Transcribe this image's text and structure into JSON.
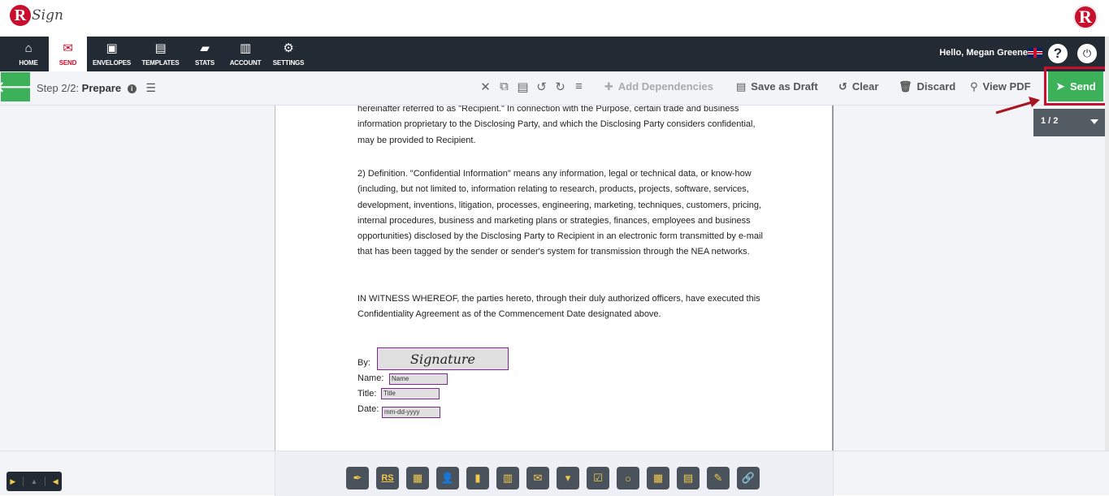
{
  "brand": {
    "logo_letter": "R",
    "logo_text": "Sign"
  },
  "nav": {
    "items": [
      {
        "label": "HOME",
        "icon": "home-icon",
        "glyph": "⌂"
      },
      {
        "label": "SEND",
        "icon": "envelope-icon",
        "glyph": "✉"
      },
      {
        "label": "ENVELOPES",
        "icon": "inbox-icon",
        "glyph": "▣"
      },
      {
        "label": "TEMPLATES",
        "icon": "templates-icon",
        "glyph": "▤"
      },
      {
        "label": "STATS",
        "icon": "briefcase-icon",
        "glyph": "▰"
      },
      {
        "label": "ACCOUNT",
        "icon": "account-icon",
        "glyph": "▥"
      },
      {
        "label": "SETTINGS",
        "icon": "gear-icon",
        "glyph": "⚙"
      }
    ],
    "active": "SEND",
    "greeting": "Hello, Megan Greene",
    "help_glyph": "?",
    "power_glyph": "⏻"
  },
  "toolbar": {
    "step_prefix": "Step 2/2:",
    "step_name": "Prepare",
    "add_dependencies": "Add Dependencies",
    "save_as_draft": "Save as Draft",
    "clear": "Clear",
    "discard": "Discard",
    "view_pdf": "View PDF",
    "send": "Send"
  },
  "pager": {
    "label": "1 / 2"
  },
  "document": {
    "para1": "hereinafter referred to as \"Recipient.\"  In connection with the Purpose, certain trade and business information proprietary to the Disclosing Party, and which the Disclosing Party considers confidential, may be provided to Recipient.",
    "para2": "2) Definition.  \"Confidential Information\" means any information, legal or technical data, or know-how (including, but not limited to, information relating to research, products, projects, software, services, development, inventions, litigation, processes, engineering, marketing, techniques, customers, pricing, internal procedures, business and marketing plans or strategies, finances, employees and business opportunities) disclosed by the Disclosing Party to Recipient in an electronic form transmitted by e-mail that has been tagged by the sender or sender's system for transmission through the NEA networks.",
    "para3": "IN WITNESS WHEREOF, the parties hereto, through their duly authorized officers, have executed this Confidentiality Agreement as of the Commencement Date designated above.",
    "by_label": "By:",
    "name_label": "Name:",
    "title_label": "Title:",
    "date_label": "Date:",
    "signature_field": "Signature",
    "name_field": "Name",
    "title_field": "Title",
    "date_field": "mm-dd-yyyy"
  },
  "colors": {
    "accent_green": "#3cb15a",
    "brand_red": "#c8102e",
    "nav_dark": "#222a33",
    "tool_yellow": "#f2c94c"
  },
  "tools": [
    {
      "name": "signature-tool",
      "glyph": "✒"
    },
    {
      "name": "initials-tool",
      "glyph": "RS"
    },
    {
      "name": "stamp-tool",
      "glyph": "▦"
    },
    {
      "name": "name-tool",
      "glyph": "👤"
    },
    {
      "name": "title-tool",
      "glyph": "▮"
    },
    {
      "name": "company-tool",
      "glyph": "▥"
    },
    {
      "name": "email-tool",
      "glyph": "✉"
    },
    {
      "name": "dropdown-tool",
      "glyph": "▾"
    },
    {
      "name": "checkbox-tool",
      "glyph": "☑"
    },
    {
      "name": "radio-tool",
      "glyph": "○"
    },
    {
      "name": "date-tool",
      "glyph": "▦"
    },
    {
      "name": "text-tool",
      "glyph": "▤"
    },
    {
      "name": "label-tool",
      "glyph": "✎"
    },
    {
      "name": "hyperlink-tool",
      "glyph": "🔗"
    }
  ]
}
